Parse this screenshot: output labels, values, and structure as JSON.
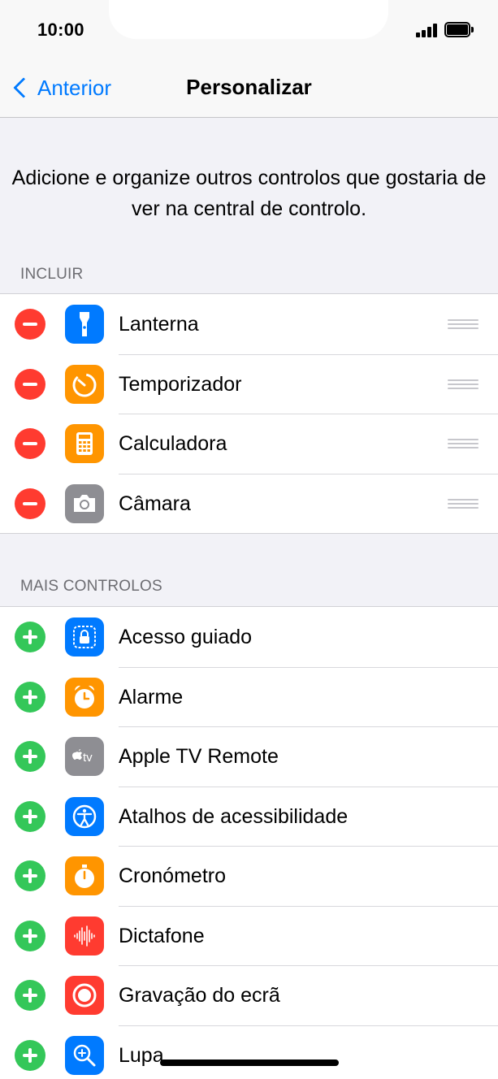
{
  "status_bar": {
    "time": "10:00"
  },
  "nav": {
    "back_label": "Anterior",
    "title": "Personalizar"
  },
  "intro_text": "Adicione e organize outros controlos que gostaria de ver na central de controlo.",
  "include": {
    "header": "INCLUIR",
    "items": [
      {
        "label": "Lanterna",
        "icon": "flashlight-icon",
        "color": "#007aff"
      },
      {
        "label": "Temporizador",
        "icon": "timer-icon",
        "color": "#ff9500"
      },
      {
        "label": "Calculadora",
        "icon": "calculator-icon",
        "color": "#ff9500"
      },
      {
        "label": "Câmara",
        "icon": "camera-icon",
        "color": "#8e8e93"
      }
    ]
  },
  "more": {
    "header": "MAIS CONTROLOS",
    "items": [
      {
        "label": "Acesso guiado",
        "icon": "guided-access-icon",
        "color": "#007aff"
      },
      {
        "label": "Alarme",
        "icon": "alarm-icon",
        "color": "#ff9500"
      },
      {
        "label": "Apple TV Remote",
        "icon": "apple-tv-icon",
        "color": "#8e8e93",
        "icon_text": "tv"
      },
      {
        "label": "Atalhos de acessibilidade",
        "icon": "accessibility-icon",
        "color": "#007aff"
      },
      {
        "label": "Cronómetro",
        "icon": "stopwatch-icon",
        "color": "#ff9500"
      },
      {
        "label": "Dictafone",
        "icon": "voice-memo-icon",
        "color": "#ff3b30"
      },
      {
        "label": "Gravação do ecrã",
        "icon": "screen-record-icon",
        "color": "#ff3b30"
      },
      {
        "label": "Lupa",
        "icon": "magnifier-icon",
        "color": "#007aff"
      }
    ]
  },
  "colors": {
    "accent": "#007aff",
    "remove": "#ff3b30",
    "add": "#34c759",
    "background": "#f2f2f7"
  }
}
